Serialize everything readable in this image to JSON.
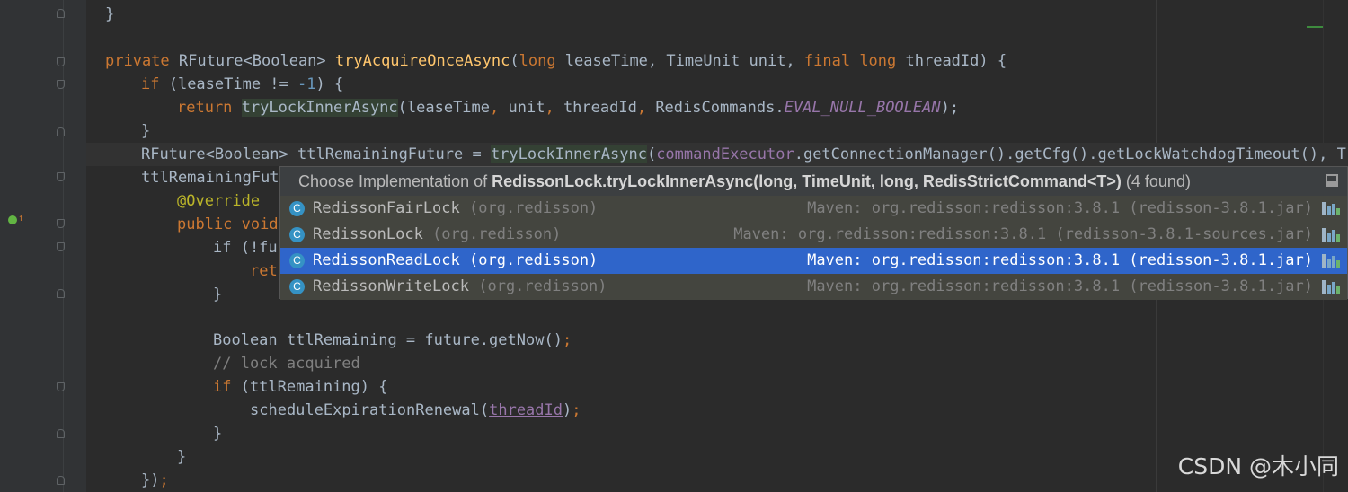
{
  "code_lines": {
    "l0": "}",
    "l2_a": "private ",
    "l2_b": "RFuture<Boolean> ",
    "l2_c": "tryAcquireOnceAsync",
    "l2_d": "(",
    "l2_e": "long ",
    "l2_f": "leaseTime, TimeUnit unit, ",
    "l2_g": "final long ",
    "l2_h": "threadId) {",
    "l3_a": "if ",
    "l3_b": "(leaseTime != ",
    "l3_c": "-1",
    "l3_d": ") {",
    "l4_a": "return ",
    "l4_b": "tryLockInnerAsync",
    "l4_c": "(leaseTime",
    "l4_d": ", ",
    "l4_e": "unit",
    "l4_f": ", ",
    "l4_g": "threadId",
    "l4_h": ", ",
    "l4_i": "RedisCommands.",
    "l4_j": "EVAL_NULL_BOOLEAN",
    "l4_k": ");",
    "l5": "}",
    "l6_a": "RFuture<Boolean> ttlRemainingFuture = ",
    "l6_b": "tryLockInnerAsync",
    "l6_c": "(",
    "l6_d": "commandExecutor",
    "l6_e": ".getConnectionManager().getCfg().getLockWatchdogTimeout()",
    "l6_f": ", T",
    "l7": "ttlRemainingFutu",
    "l8": "@Override",
    "l9_a": "public void",
    "l10": "if (!fu",
    "l11": "retu",
    "l12": "}",
    "l14_a": "Boolean ttlRemaining = future.getNow()",
    "l14_b": ";",
    "l15": "// lock acquired",
    "l16_a": "if ",
    "l16_b": "(ttlRemaining) {",
    "l17_a": "scheduleExpirationRenewal(",
    "l17_b": "threadId",
    "l17_c": ")",
    "l17_d": ";",
    "l18": "}",
    "l19": "}",
    "l20_a": "})",
    "l20_b": ";"
  },
  "popup": {
    "title_prefix": "Choose Implementation of ",
    "title_method": "RedissonLock.tryLockInnerAsync(long, TimeUnit, long, RedisStrictCommand<T>)",
    "title_count": " (4 found)",
    "items": [
      {
        "icon": "C",
        "name": "RedissonFairLock",
        "package": " (org.redisson)",
        "location": "Maven: org.redisson:redisson:3.8.1 (redisson-3.8.1.jar)"
      },
      {
        "icon": "C",
        "name": "RedissonLock",
        "package": " (org.redisson)",
        "location": "Maven: org.redisson:redisson:3.8.1 (redisson-3.8.1-sources.jar)"
      },
      {
        "icon": "C",
        "name": "RedissonReadLock",
        "package": " (org.redisson)",
        "location": "Maven: org.redisson:redisson:3.8.1 (redisson-3.8.1.jar)"
      },
      {
        "icon": "C",
        "name": "RedissonWriteLock",
        "package": " (org.redisson)",
        "location": "Maven: org.redisson:redisson:3.8.1 (redisson-3.8.1.jar)"
      }
    ]
  },
  "watermark": "CSDN @木小同"
}
